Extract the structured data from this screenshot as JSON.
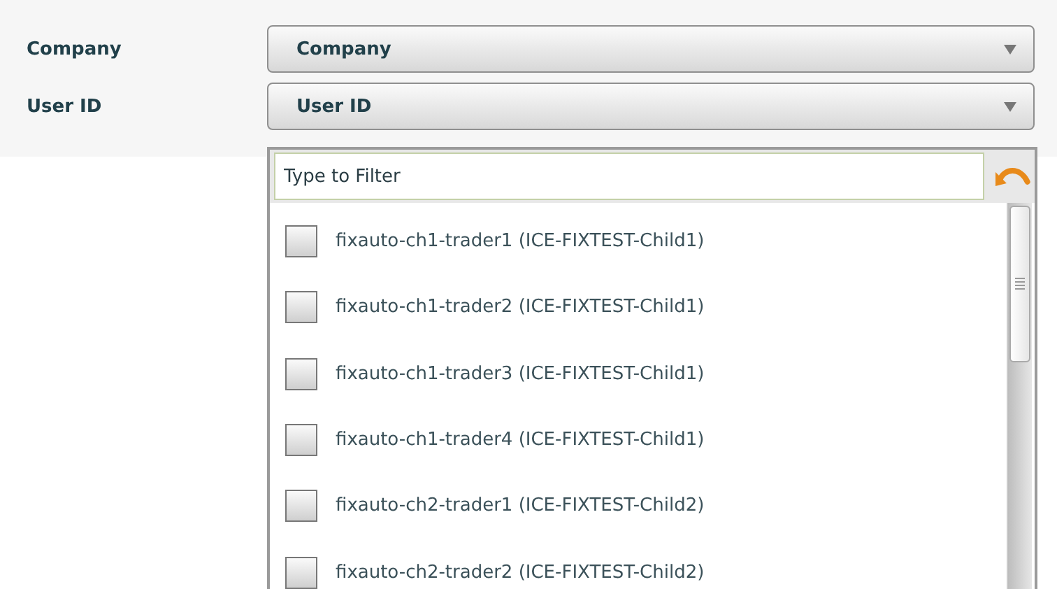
{
  "fields": [
    {
      "label": "Company",
      "value": "Company"
    },
    {
      "label": "User ID",
      "value": "User ID"
    }
  ],
  "dropdown": {
    "filter": {
      "placeholder": "Type to Filter"
    },
    "options": [
      {
        "label": "fixauto-ch1-trader1 (ICE-FIXTEST-Child1)",
        "checked": false
      },
      {
        "label": "fixauto-ch1-trader2 (ICE-FIXTEST-Child1)",
        "checked": false
      },
      {
        "label": "fixauto-ch1-trader3 (ICE-FIXTEST-Child1)",
        "checked": false
      },
      {
        "label": "fixauto-ch1-trader4 (ICE-FIXTEST-Child1)",
        "checked": false
      },
      {
        "label": "fixauto-ch2-trader1 (ICE-FIXTEST-Child2)",
        "checked": false
      },
      {
        "label": "fixauto-ch2-trader2 (ICE-FIXTEST-Child2)",
        "checked": false
      }
    ]
  }
}
